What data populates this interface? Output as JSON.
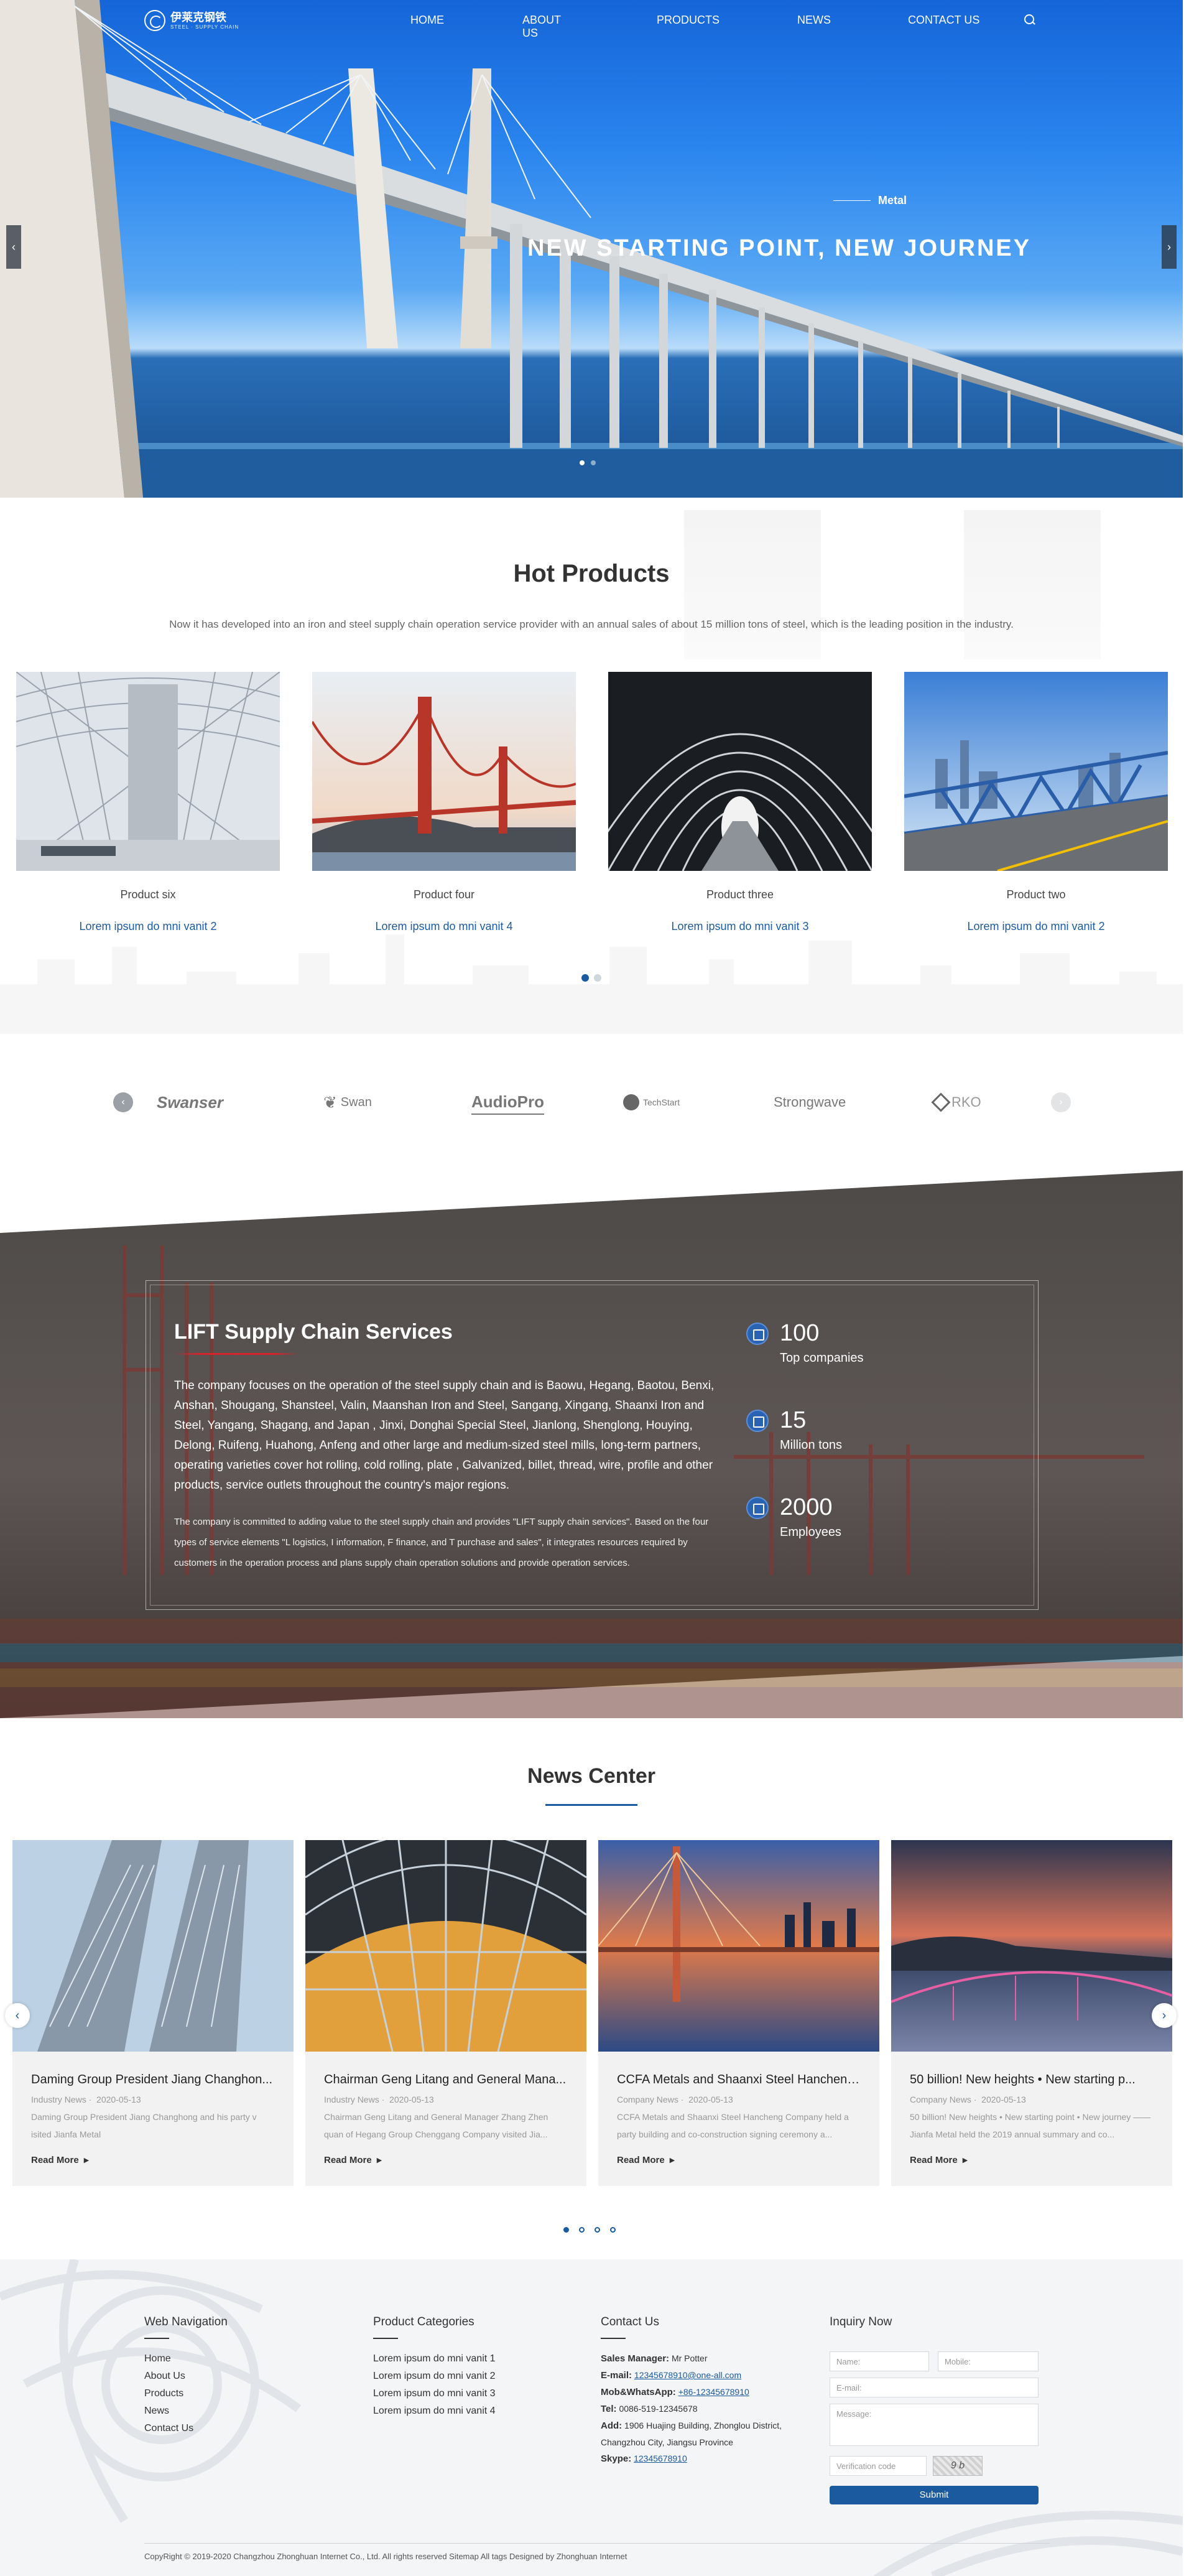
{
  "header": {
    "logo_text": "伊莱克钢铁",
    "logo_sub": "STEEL · SUPPLY CHAIN",
    "nav": [
      "HOME",
      "ABOUT US",
      "PRODUCTS",
      "NEWS",
      "CONTACT US"
    ]
  },
  "hero": {
    "tag": "Metal",
    "title": "NEW  STARTING  POINT,  NEW  JOURNEY",
    "prev": "‹",
    "next": "›"
  },
  "hot_products": {
    "title": "Hot Products",
    "description": "Now it has developed into an iron and steel supply chain operation service provider with an annual sales of about 15 million tons of steel, which is the leading position in the industry.",
    "items": [
      {
        "name": "Product six",
        "link": "Lorem ipsum do mni vanit 2"
      },
      {
        "name": "Product four",
        "link": "Lorem ipsum do mni vanit 4"
      },
      {
        "name": "Product three",
        "link": "Lorem ipsum do mni vanit 3"
      },
      {
        "name": "Product two",
        "link": "Lorem ipsum do mni vanit 2"
      }
    ]
  },
  "brands": [
    "Swanser",
    "Swan",
    "AudioPro",
    "TechStart",
    "Strongwave",
    "RKO"
  ],
  "services": {
    "title": "LIFT Supply Chain Services",
    "paragraph1": "The company focuses on the operation of the steel supply chain and is Baowu, Hegang, Baotou, Benxi, Anshan, Shougang, Shansteel, Valin, Maanshan Iron and Steel, Sangang, Xingang, Shaanxi Iron and Steel, Yangang, Shagang, and Japan , Jinxi, Donghai Special Steel, Jianlong, Shenglong, Houying, Delong, Ruifeng, Huahong, Anfeng and other large and medium-sized steel mills, long-term partners, operating varieties cover hot rolling, cold rolling, plate , Galvanized, billet, thread, wire, profile and other products, service outlets throughout the country's major regions.",
    "paragraph2": "The company is committed to adding value to the steel supply chain and provides \"LIFT supply chain services\". Based on the four types of service elements \"L logistics, I information, F finance, and T purchase and sales\", it integrates resources required by customers in the operation process and plans supply chain operation solutions and provide operation services.",
    "stats": [
      {
        "number": "100",
        "label": "Top companies"
      },
      {
        "number": "15",
        "label": "Million tons"
      },
      {
        "number": "2000",
        "label": "Employees"
      }
    ]
  },
  "news": {
    "title": "News Center",
    "read_more": "Read More",
    "items": [
      {
        "title": "Daming Group President Jiang Changhon...",
        "category": "Industry News",
        "date": "2020-05-13",
        "excerpt": "Daming Group President Jiang Changhong and his party v isited Jianfa Metal"
      },
      {
        "title": "Chairman Geng Litang and General Mana...",
        "category": "Industry News",
        "date": "2020-05-13",
        "excerpt": "Chairman Geng Litang and General Manager Zhang Zhen quan of Hegang Group Chenggang Company visited Jia..."
      },
      {
        "title": "CCFA Metals and Shaanxi Steel Hancheng...",
        "category": "Company News",
        "date": "2020-05-13",
        "excerpt": "CCFA Metals and Shaanxi Steel Hancheng Company held a party building and co-construction signing ceremony a..."
      },
      {
        "title": "50 billion! New heights • New starting p...",
        "category": "Company News",
        "date": "2020-05-13",
        "excerpt": "50 billion! New heights • New starting point • New journey ——Jianfa Metal held the 2019 annual summary and co..."
      }
    ]
  },
  "footer": {
    "web_nav": {
      "title": "Web Navigation",
      "links": [
        "Home",
        "About Us",
        "Products",
        "News",
        "Contact Us"
      ]
    },
    "categories": {
      "title": "Product Categories",
      "links": [
        "Lorem ipsum do mni vanit 1",
        "Lorem ipsum do mni vanit 2",
        "Lorem ipsum do mni vanit 3",
        "Lorem ipsum do mni vanit 4"
      ]
    },
    "contact": {
      "title": "Contact Us",
      "manager_label": "Sales Manager:",
      "manager": "Mr Potter",
      "email_label": "E-mail:",
      "email": "12345678910@one-all.com",
      "mob_label": "Mob&WhatsApp:",
      "mob": "+86-12345678910",
      "tel_label": "Tel:",
      "tel": "0086-519-12345678",
      "add_label": "Add:",
      "address": "1906 Huajing Building, Zhonglou District, Changzhou City, Jiangsu Province",
      "skype_label": "Skype:",
      "skype": "12345678910"
    },
    "inquiry": {
      "title": "Inquiry Now",
      "name_ph": "Name:",
      "mobile_ph": "Mobile:",
      "email_ph": "E-mail:",
      "message_ph": "Message:",
      "code_ph": "Verification code",
      "captcha": "9 b",
      "submit": "Submit"
    },
    "copyright": "CopyRight © 2019-2020   Changzhou Zhonghuan Internet Co., Ltd.  All rights reserved   Sitemap   All tags    Designed by Zhonghuan Internet"
  },
  "colors": {
    "brand_blue": "#1c5aa0",
    "accent_red": "#d8242c"
  }
}
